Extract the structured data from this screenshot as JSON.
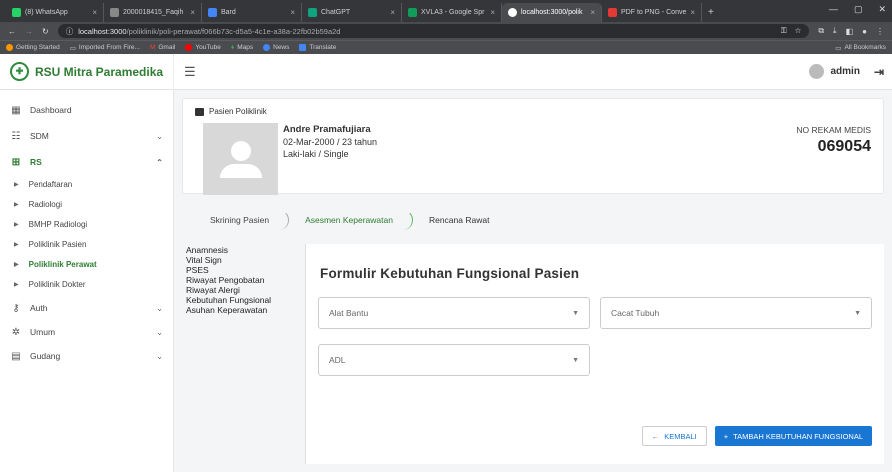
{
  "browser": {
    "tabs": [
      {
        "label": "(8) WhatsApp",
        "color": "#25D366"
      },
      {
        "label": "2000018415_Faqih",
        "color": "#888888"
      },
      {
        "label": "Bard",
        "color": "#4285F4"
      },
      {
        "label": "ChatGPT",
        "color": "#10a37f"
      },
      {
        "label": "XVLA3 - Google Spr",
        "color": "#0F9D58"
      },
      {
        "label": "localhost:3000/polik",
        "color": "#ffffff"
      },
      {
        "label": "PDF to PNG - Conve",
        "color": "#e53935"
      }
    ],
    "active_tab": 5,
    "url_host": "localhost:3000",
    "url_path": "/poliklinik/poli-perawat/f066b73c-d5a5-4c1e-a38a-22fb02b59a2d",
    "bookmarks": [
      "Getting Started",
      "Imported From Fire...",
      "Gmail",
      "YouTube",
      "Maps",
      "News",
      "Translate"
    ],
    "all_bookmarks": "All Bookmarks"
  },
  "app": {
    "brand": "RSU Mitra Paramedika",
    "user": "admin"
  },
  "sidebar": {
    "items": [
      {
        "label": "Dashboard",
        "icon": "grid-icon"
      },
      {
        "label": "SDM",
        "icon": "users-icon"
      },
      {
        "label": "RS",
        "icon": "plus-box-icon"
      }
    ],
    "rs_sub": [
      "Pendaftaran",
      "Radiologi",
      "BMHP Radiologi",
      "Poliklinik Pasien",
      "Poliklinik Perawat",
      "Poliklinik Dokter"
    ],
    "bottom": [
      {
        "label": "Auth",
        "icon": "key-icon"
      },
      {
        "label": "Umum",
        "icon": "gear-icon"
      },
      {
        "label": "Gudang",
        "icon": "archive-icon"
      }
    ]
  },
  "patient": {
    "section_title": "Pasien Poliklinik",
    "name": "Andre Pramafujiara",
    "dob_age": "02-Mar-2000 / 23 tahun",
    "gender_status": "Laki-laki / Single",
    "rm_label": "NO REKAM MEDIS",
    "rm_number": "069054"
  },
  "steps": [
    "Skrining Pasien",
    "Asesmen Keperawatan",
    "Rencana Rawat"
  ],
  "left_menu": [
    "Anamnesis",
    "Vital Sign",
    "PSES",
    "Riwayat Pengobatan",
    "Riwayat Alergi",
    "Kebutuhan Fungsional",
    "Asuhan Keperawatan"
  ],
  "form": {
    "title": "Formulir Kebutuhan Fungsional Pasien",
    "alat_bantu": "Alat Bantu",
    "cacat_tubuh": "Cacat Tubuh",
    "adl": "ADL",
    "back": "KEMBALI",
    "add": "TAMBAH KEBUTUHAN FUNGSIONAL"
  }
}
